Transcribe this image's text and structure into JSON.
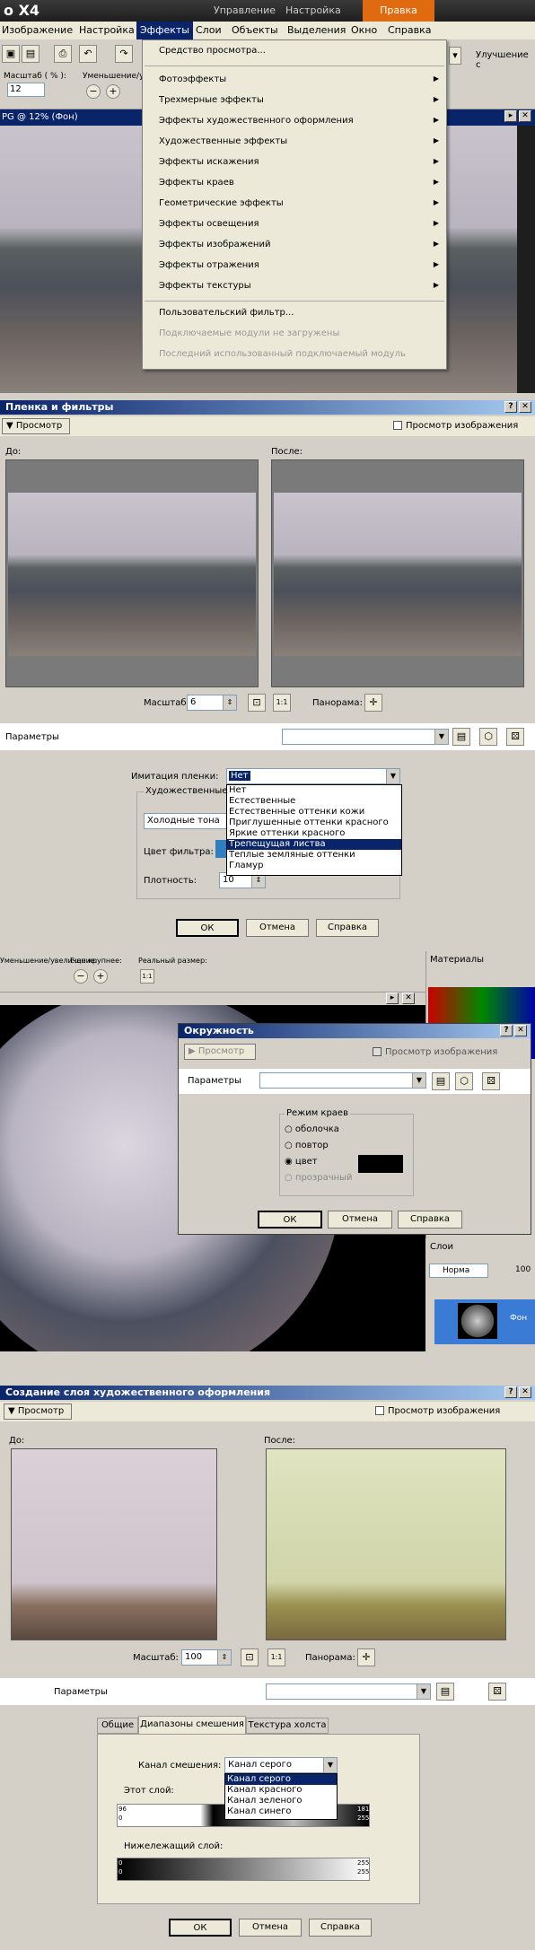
{
  "app": {
    "title": "o X4",
    "ribbon_tabs": [
      "Управление",
      "Настройка",
      "Правка"
    ],
    "menubar": [
      "Изображение",
      "Настройка",
      "Эффекты",
      "Слои",
      "Объекты",
      "Выделения",
      "Окно",
      "Справка"
    ],
    "toolbar": {
      "zoom_label": "Масштаб ( % ):",
      "zoom_value": "12",
      "reduce_label": "Уменьшение/у",
      "improve": "Улучшение с"
    },
    "doc_tab": "PG @ 12% (Фон)"
  },
  "effects_menu": {
    "items": [
      {
        "label": "Средство просмотра...",
        "arrow": false,
        "disabled": false
      },
      {
        "label": "Фотоэффекты",
        "arrow": true,
        "disabled": false
      },
      {
        "label": "Трехмерные эффекты",
        "arrow": true,
        "disabled": false
      },
      {
        "label": "Эффекты художественного оформления",
        "arrow": true,
        "disabled": false
      },
      {
        "label": "Художественные эффекты",
        "arrow": true,
        "disabled": false
      },
      {
        "label": "Эффекты искажения",
        "arrow": true,
        "disabled": false
      },
      {
        "label": "Эффекты краев",
        "arrow": true,
        "disabled": false
      },
      {
        "label": "Геометрические эффекты",
        "arrow": true,
        "disabled": false
      },
      {
        "label": "Эффекты освещения",
        "arrow": true,
        "disabled": false
      },
      {
        "label": "Эффекты изображений",
        "arrow": true,
        "disabled": false
      },
      {
        "label": "Эффекты отражения",
        "arrow": true,
        "disabled": false
      },
      {
        "label": "Эффекты текстуры",
        "arrow": true,
        "disabled": false
      },
      {
        "label": "Пользовательский фильтр...",
        "arrow": false,
        "disabled": false
      },
      {
        "label": "Подключаемые модули не загружены",
        "arrow": false,
        "disabled": true
      },
      {
        "label": "Последний использованный подключаемый модуль",
        "arrow": false,
        "disabled": true
      }
    ]
  },
  "film": {
    "title": "Пленка и фильтры",
    "preview": "Просмотр",
    "preview_image": "Просмотр изображения",
    "before": "До:",
    "after": "После:",
    "scale_label": "Масштаб:",
    "scale_value": "6",
    "pan_label": "Панорама:",
    "params": "Параметры",
    "imitation_label": "Имитация пленки:",
    "imitation_value": "Нет",
    "options": [
      "Нет",
      "Естественные",
      "Естественные оттенки кожи",
      "Приглушенные оттенки красного",
      "Яркие оттенки красного",
      "Трепещущая листва",
      "Теплые земляные оттенки",
      "Гламур"
    ],
    "selected_option": "Трепещущая листва",
    "art_group": "Художественные ф",
    "art_value": "Холодные тона",
    "filter_color": "Цвет фильтра:",
    "density": "Плотность:",
    "density_value": "10",
    "ok": "ОК",
    "cancel": "Отмена",
    "help": "Справка"
  },
  "circle": {
    "title": "Окружность",
    "toolbar": {
      "zoom": "Уменьшение/увеличение:",
      "zoom_more": "Еще крупнее:",
      "real": "Реальный размер:"
    },
    "materials": "Материалы",
    "layers": "Слои",
    "blend": "Норма",
    "opacity": "100",
    "layer_name": "Фон",
    "preview": "Просмотр",
    "preview_image": "Просмотр изображения",
    "params": "Параметры",
    "edge_mode": "Режим краев",
    "modes": [
      "оболочка",
      "повтор",
      "цвет",
      "прозрачный"
    ],
    "selected_mode": "цвет",
    "ok": "ОК",
    "cancel": "Отмена",
    "help": "Справка"
  },
  "art": {
    "title": "Создание слоя художественного оформления",
    "preview": "Просмотр",
    "preview_image": "Просмотр изображения",
    "before": "До:",
    "after": "После:",
    "scale_label": "Масштаб:",
    "scale_value": "100",
    "pan_label": "Панорама:",
    "params": "Параметры",
    "tabs": [
      "Общие",
      "Диапазоны смешения",
      "Текстура холста"
    ],
    "channel_label": "Канал смешения:",
    "channel_value": "Канал серого",
    "channels": [
      "Канал серого",
      "Канал красного",
      "Канал зеленого",
      "Канал синего"
    ],
    "this_layer": "Этот слой:",
    "under_layer": "Нижележащий слой:",
    "range_left": "96",
    "range_left2": "0",
    "range_right": "181",
    "range_right2": "255",
    "under_left": "0",
    "under_left2": "0",
    "under_right": "255",
    "under_right2": "255",
    "ok": "ОК",
    "cancel": "Отмена",
    "help": "Справка"
  }
}
